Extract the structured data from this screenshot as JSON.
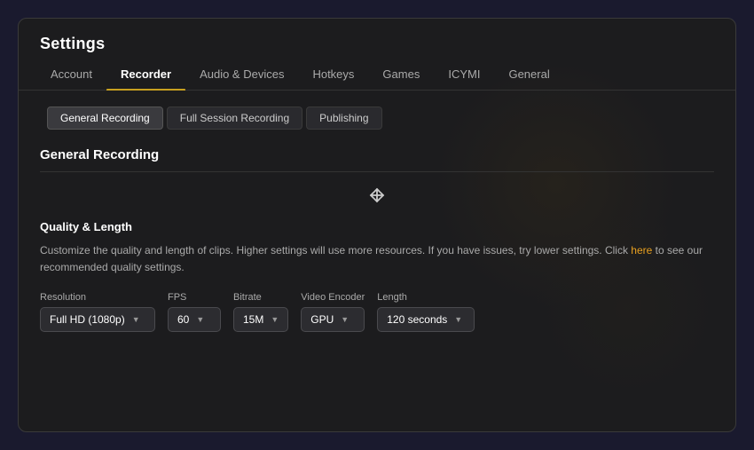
{
  "window": {
    "title": "Settings"
  },
  "nav": {
    "tabs": [
      {
        "id": "account",
        "label": "Account",
        "active": false
      },
      {
        "id": "recorder",
        "label": "Recorder",
        "active": true
      },
      {
        "id": "audio-devices",
        "label": "Audio & Devices",
        "active": false
      },
      {
        "id": "hotkeys",
        "label": "Hotkeys",
        "active": false
      },
      {
        "id": "games",
        "label": "Games",
        "active": false
      },
      {
        "id": "icymi",
        "label": "ICYMI",
        "active": false
      },
      {
        "id": "general",
        "label": "General",
        "active": false
      }
    ]
  },
  "sub_tabs": [
    {
      "id": "general-recording",
      "label": "General Recording",
      "active": true
    },
    {
      "id": "full-session-recording",
      "label": "Full Session Recording",
      "active": false
    },
    {
      "id": "publishing",
      "label": "Publishing",
      "active": false
    }
  ],
  "section": {
    "title": "General Recording",
    "quality": {
      "heading": "Quality & Length",
      "description_part1": "Customize the quality and length of clips. Higher settings will use more resources. If you have issues, try lower settings. Click ",
      "link_text": "here",
      "description_part2": " to see our recommended quality settings."
    },
    "dropdowns": [
      {
        "label": "Resolution",
        "value": "Full HD (1080p)",
        "arrow": "▼",
        "size": "wide"
      },
      {
        "label": "FPS",
        "value": "60",
        "arrow": "▼",
        "size": "med"
      },
      {
        "label": "Bitrate",
        "value": "15M",
        "arrow": "▼",
        "size": "med"
      },
      {
        "label": "Video Encoder",
        "value": "GPU",
        "arrow": "▼",
        "size": "med"
      },
      {
        "label": "Length",
        "value": "120 seconds",
        "arrow": "▼",
        "size": "length"
      }
    ]
  }
}
